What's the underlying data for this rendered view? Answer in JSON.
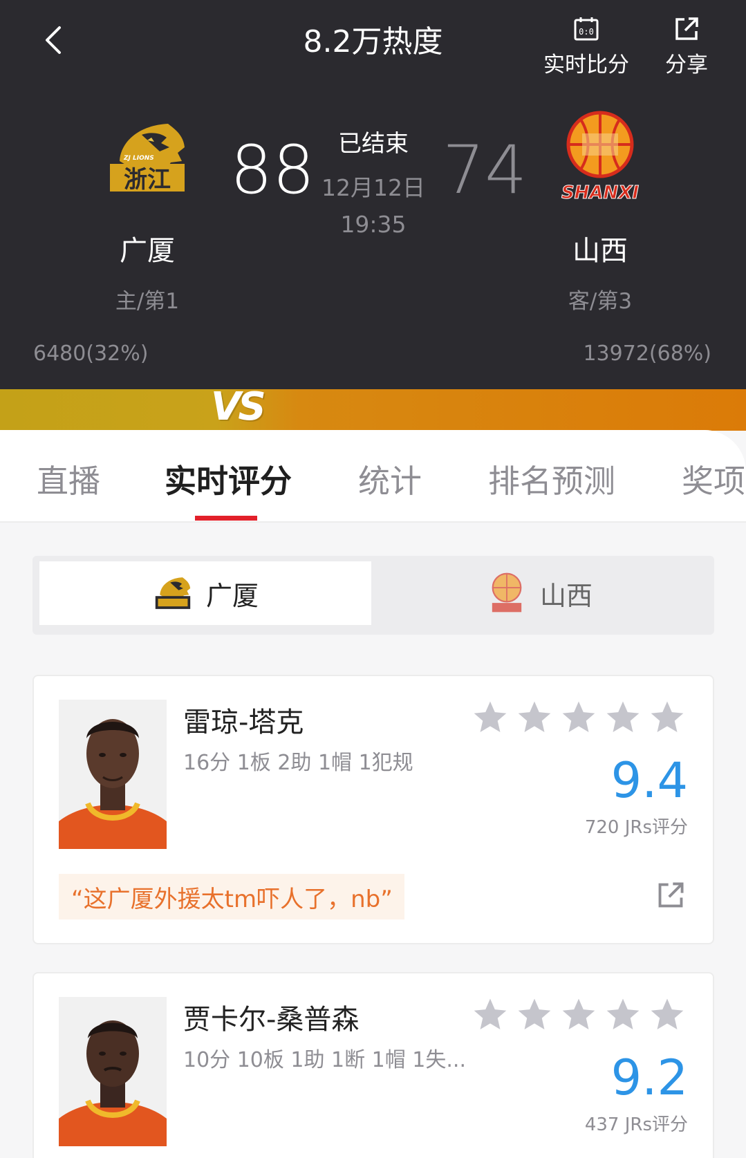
{
  "header": {
    "heat": "8.2万热度",
    "live_score_label": "实时比分",
    "share_label": "分享"
  },
  "game": {
    "status": "已结束",
    "date": "12月12日",
    "time": "19:35",
    "vs_mark": "VS",
    "home": {
      "name": "广厦",
      "score": "88",
      "rank": "主/第1",
      "support": "6480(32%)",
      "logo_text_top": "ZJ LIONS",
      "logo_text": "浙江"
    },
    "away": {
      "name": "山西",
      "score": "74",
      "rank": "客/第3",
      "support": "13972(68%)",
      "logo_text": "SHANXI"
    }
  },
  "tabs": [
    "直播",
    "实时评分",
    "统计",
    "排名预测",
    "奖项"
  ],
  "active_tab": "实时评分",
  "team_switch": {
    "selected": "广厦",
    "other": "山西"
  },
  "players": [
    {
      "name": "雷琼-塔克",
      "stats": "16分 1板 2助 1帽 1犯规",
      "rating": "9.4",
      "votes": "720 JRs评分",
      "comment": "“这广厦外援太tm吓人了，nb”"
    },
    {
      "name": "贾卡尔-桑普森",
      "stats": "10分 10板 1助 1断 1帽 1失...",
      "rating": "9.2",
      "votes": "437 JRs评分"
    }
  ],
  "colors": {
    "header_bg": "#2b2a2f",
    "accent_red": "#e2202a",
    "rating_blue": "#2d94e6",
    "comment_orange": "#e8712c",
    "star_gray": "#c5c5cc"
  }
}
